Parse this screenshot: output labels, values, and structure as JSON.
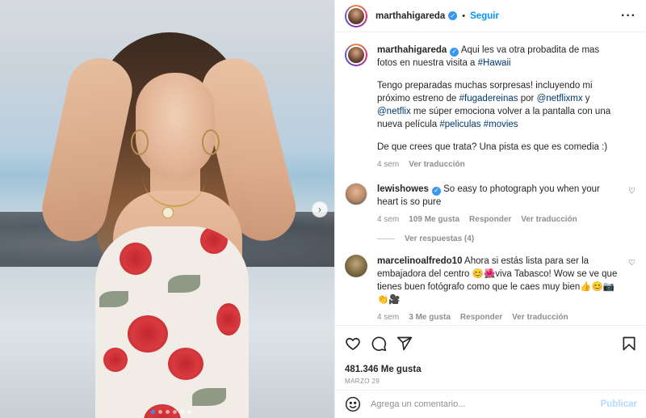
{
  "post": {
    "author": "marthahigareda",
    "follow_label": "Seguir",
    "more_label": "···",
    "next_label": "›",
    "carousel_count": 6,
    "carousel_active": 1
  },
  "caption": {
    "author": "marthahigareda",
    "line1_text": "Aqui les va otra probadita de mas fotos en nuestra visita a ",
    "line1_tag": "#Hawaii",
    "p2_a": "Tengo preparadas muchas sorpresas! incluyendo mi próximo estreno de ",
    "p2_tag1": "#fugadereinas",
    "p2_b": " por ",
    "p2_tag2": "@netflixmx",
    "p2_c": " y ",
    "p2_tag3": "@netflix",
    "p2_d": " me súper emociona volver a la pantalla con una nueva película ",
    "p2_tag4": "#peliculas",
    "p2_e": " ",
    "p2_tag5": "#movies",
    "p3": "De que crees que trata? Una pista es que es comedia :)",
    "time": "4 sem",
    "translate": "Ver traducción"
  },
  "comments": [
    {
      "author": "lewishowes",
      "verified": true,
      "text": "So easy to photograph you when your heart is so pure",
      "time": "4 sem",
      "likes": "109 Me gusta",
      "reply": "Responder",
      "translate": "Ver traducción",
      "replies": "Ver respuestas (4)"
    },
    {
      "author": "marcelinoalfredo10",
      "verified": false,
      "text": "Ahora si estás lista para ser la embajadora del centro 😊🌺viva Tabasco! Wow se ve que tienes buen fotógrafo como que le caes muy bien👍😊📷👏🎥",
      "time": "4 sem",
      "likes": "3 Me gusta",
      "reply": "Responder",
      "translate": "Ver traducción"
    }
  ],
  "stats": {
    "likes": "481.346 Me gusta",
    "date": "MARZO 29"
  },
  "composer": {
    "placeholder": "Agrega un comentario...",
    "publish_label": "Publicar"
  },
  "icons": {
    "verified": "verified-badge-icon",
    "like": "heart-icon",
    "comment": "comment-icon",
    "share": "paper-plane-icon",
    "save": "bookmark-icon",
    "emoji": "emoji-icon"
  },
  "colors": {
    "accent": "#0095f6",
    "verified": "#3897f0",
    "tag": "#00376b",
    "muted": "#8e8e8e",
    "publish_disabled": "#b3dbff"
  }
}
